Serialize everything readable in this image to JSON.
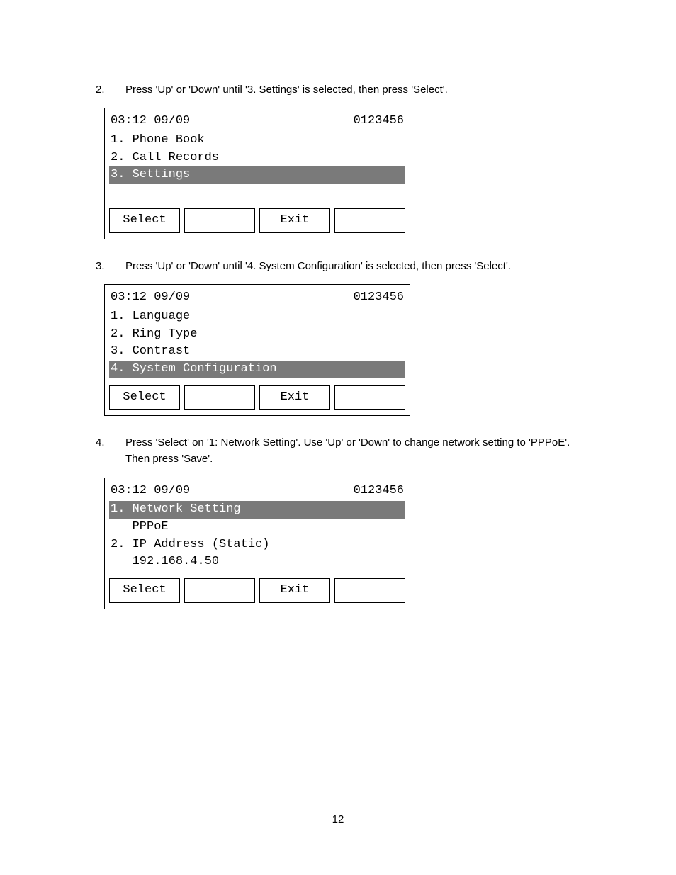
{
  "page_number": "12",
  "steps": [
    {
      "num": "2.",
      "text": "Press 'Up' or 'Down' until '3. Settings' is selected, then press 'Select'.",
      "lcd": {
        "time": "03:12 09/09",
        "code": "0123456",
        "rows": [
          {
            "text": "1. Phone Book",
            "selected": false
          },
          {
            "text": "2. Call Records",
            "selected": false
          },
          {
            "text": "3. Settings",
            "selected": true
          },
          {
            "text": "",
            "selected": false
          }
        ],
        "softkeys": [
          "Select",
          "",
          "Exit",
          ""
        ]
      }
    },
    {
      "num": "3.",
      "text": "Press 'Up' or 'Down' until '4. System Configuration' is selected, then press 'Select'.",
      "lcd": {
        "time": "03:12 09/09",
        "code": "0123456",
        "rows": [
          {
            "text": "1. Language",
            "selected": false
          },
          {
            "text": "2. Ring Type",
            "selected": false
          },
          {
            "text": "3. Contrast",
            "selected": false
          },
          {
            "text": "4. System Configuration",
            "selected": true
          }
        ],
        "softkeys": [
          "Select",
          "",
          "Exit",
          ""
        ]
      }
    },
    {
      "num": "4.",
      "text": "Press 'Select' on '1: Network Setting'.   Use 'Up' or 'Down' to change network setting to 'PPPoE'.   Then press 'Save'.",
      "lcd": {
        "time": "03:12 09/09",
        "code": "0123456",
        "rows": [
          {
            "text": "1. Network Setting",
            "selected": true
          },
          {
            "text": "   PPPoE",
            "selected": false
          },
          {
            "text": "2. IP Address (Static)",
            "selected": false
          },
          {
            "text": "   192.168.4.50",
            "selected": false
          }
        ],
        "softkeys": [
          "Select",
          "",
          "Exit",
          ""
        ]
      }
    }
  ]
}
